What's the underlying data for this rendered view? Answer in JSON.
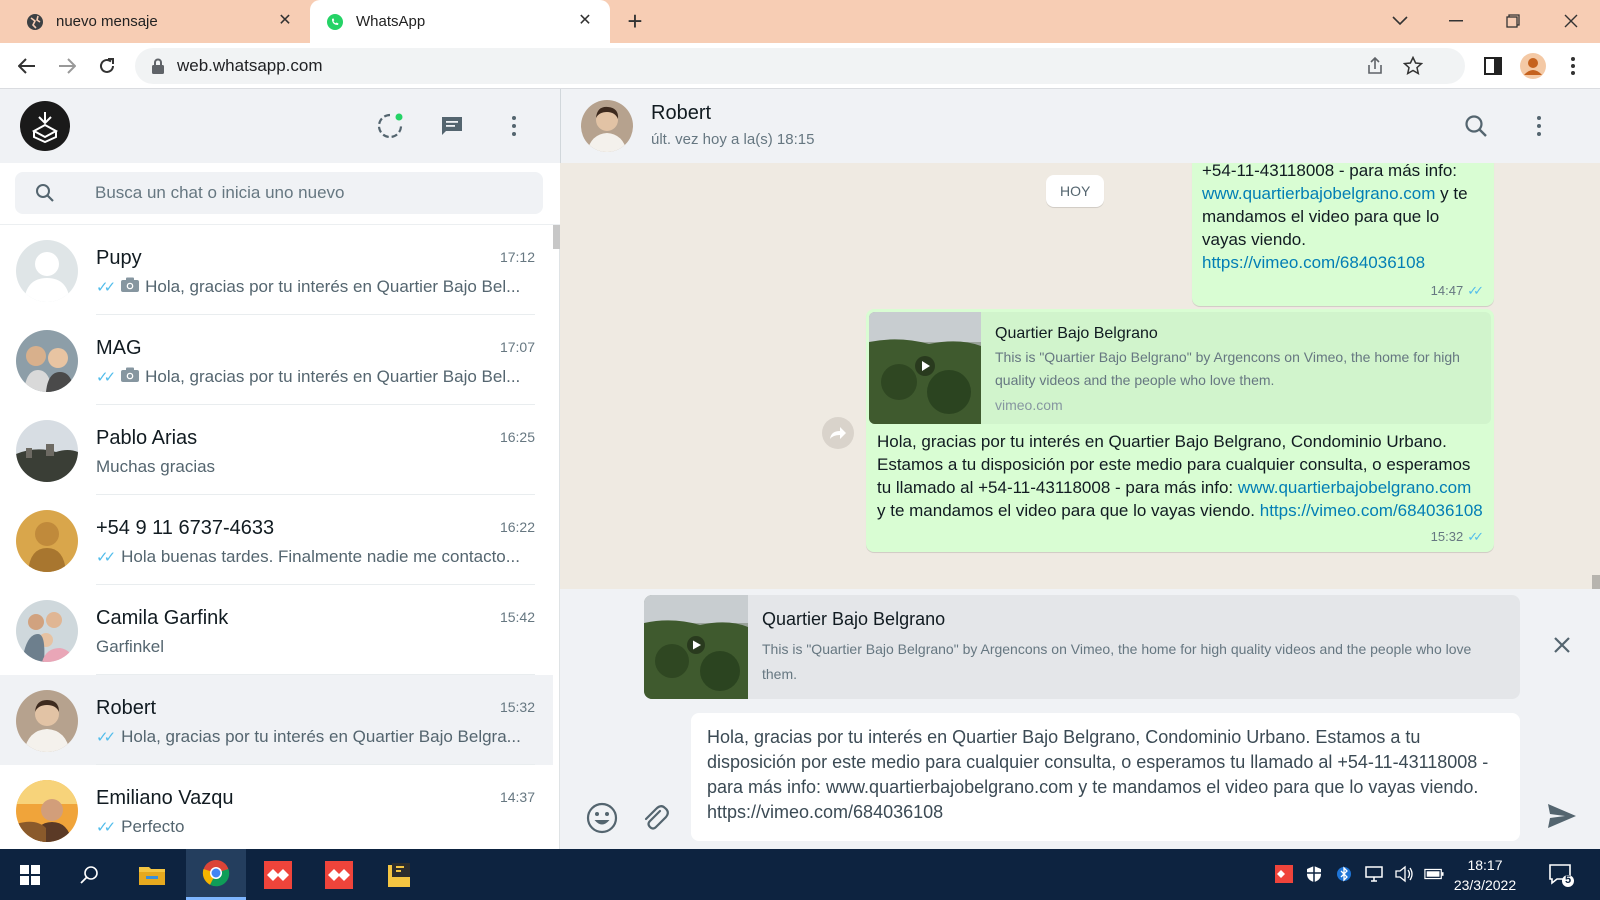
{
  "browser": {
    "tabs": [
      {
        "label": "nuevo mensaje",
        "icon": "globe-icon"
      },
      {
        "label": "WhatsApp",
        "icon": "whatsapp-icon"
      }
    ],
    "url": "web.whatsapp.com",
    "tab_close": "✕",
    "new_tab": "+"
  },
  "sidebar": {
    "search_placeholder": "Busca un chat o inicia uno nuevo",
    "chats": [
      {
        "name": "Pupy",
        "time": "17:12",
        "ticks": true,
        "photo": true,
        "preview": "Hola, gracias por tu interés en Quartier Bajo Bel..."
      },
      {
        "name": "MAG",
        "time": "17:07",
        "ticks": true,
        "photo": true,
        "preview": "Hola, gracias por tu interés en Quartier Bajo Bel..."
      },
      {
        "name": "Pablo Arias",
        "time": "16:25",
        "ticks": false,
        "photo": false,
        "preview": "Muchas gracias"
      },
      {
        "name": "+54 9 11 6737-4633",
        "time": "16:22",
        "ticks": true,
        "photo": false,
        "preview": "Hola buenas tardes. Finalmente nadie me contacto..."
      },
      {
        "name": "Camila Garfink",
        "time": "15:42",
        "ticks": false,
        "photo": false,
        "preview": "Garfinkel"
      },
      {
        "name": "Robert",
        "time": "15:32",
        "ticks": true,
        "photo": false,
        "preview": "Hola, gracias por tu interés en Quartier Bajo Belgra..."
      },
      {
        "name": "Emiliano Vazqu",
        "time": "14:37",
        "ticks": true,
        "photo": false,
        "preview": "Perfecto"
      }
    ]
  },
  "conversation": {
    "contact_name": "Robert",
    "contact_status": "últ. vez hoy a la(s) 18:15",
    "day_label": "HOY",
    "msg1": {
      "line1": "+54-11-43118008  - para más info:",
      "link1": "www.quartierbajobelgrano.com",
      "mid": " y te mandamos el video para que lo vayas viendo.",
      "link2": "https://vimeo.com/684036108",
      "time": "14:47"
    },
    "msg2": {
      "card_title": "Quartier Bajo Belgrano",
      "card_desc": "This is \"Quartier Bajo Belgrano\" by Argencons on Vimeo, the home for high quality videos and the people who love them.",
      "card_domain": "vimeo.com",
      "text_start": "Hola, gracias por tu interés en Quartier Bajo Belgrano, Condominio Urbano. Estamos a tu disposición por este medio para cualquier consulta, o esperamos tu llamado al +54-11-43118008  - para más info: ",
      "link1": "www.quartierbajobelgrano.com",
      "text_mid": " y te mandamos el video para que lo vayas viendo. ",
      "link2": "https://vimeo.com/684036108",
      "time": "15:32"
    }
  },
  "composer": {
    "preview_title": "Quartier Bajo Belgrano",
    "preview_desc": "This is \"Quartier Bajo Belgrano\" by Argencons on Vimeo, the home for high quality videos and the people who love them.",
    "text": "Hola, gracias por tu interés en Quartier Bajo Belgrano, Condominio Urbano. Estamos a tu disposición por este medio para cualquier consulta, o esperamos tu llamado al +54-11-43118008  - para más info: www.quartierbajobelgrano.com y te mandamos el video para que lo vayas viendo. https://vimeo.com/684036108"
  },
  "taskbar": {
    "time": "18:17",
    "date": "23/3/2022",
    "notification_count": "5"
  },
  "colors": {
    "outgoing_bubble": "#d9fdd3",
    "link": "#027eb5",
    "read_ticks": "#53bdeb",
    "tabbar": "#f7cdb4"
  }
}
